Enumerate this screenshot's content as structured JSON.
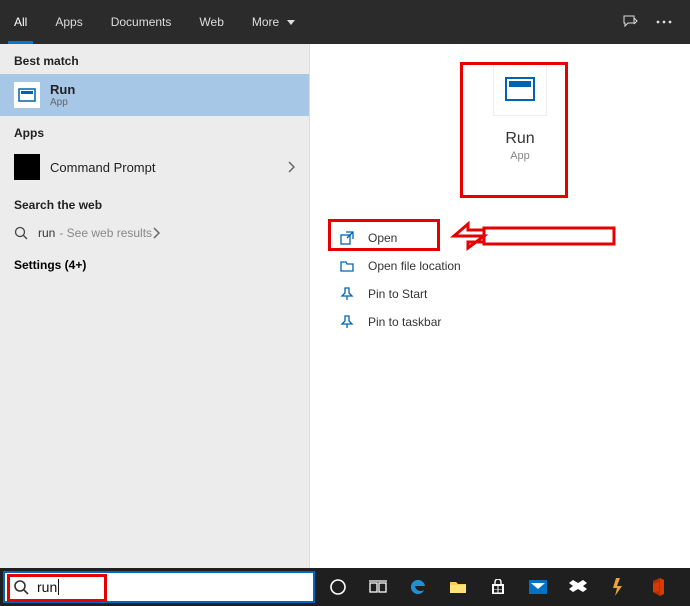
{
  "topbar": {
    "tabs": {
      "all": "All",
      "apps": "Apps",
      "documents": "Documents",
      "web": "Web",
      "more": "More"
    }
  },
  "left": {
    "best_match_label": "Best match",
    "run": {
      "title": "Run",
      "subtitle": "App"
    },
    "apps_label": "Apps",
    "cmd": {
      "title": "Command Prompt"
    },
    "search_web_label": "Search the web",
    "web_result": {
      "term": "run",
      "suffix": "- See web results"
    },
    "settings_label": "Settings (4+)"
  },
  "preview": {
    "title": "Run",
    "subtitle": "App",
    "actions": {
      "open": "Open",
      "open_file_location": "Open file location",
      "pin_start": "Pin to Start",
      "pin_taskbar": "Pin to taskbar"
    }
  },
  "taskbar": {
    "search_value": "run"
  }
}
